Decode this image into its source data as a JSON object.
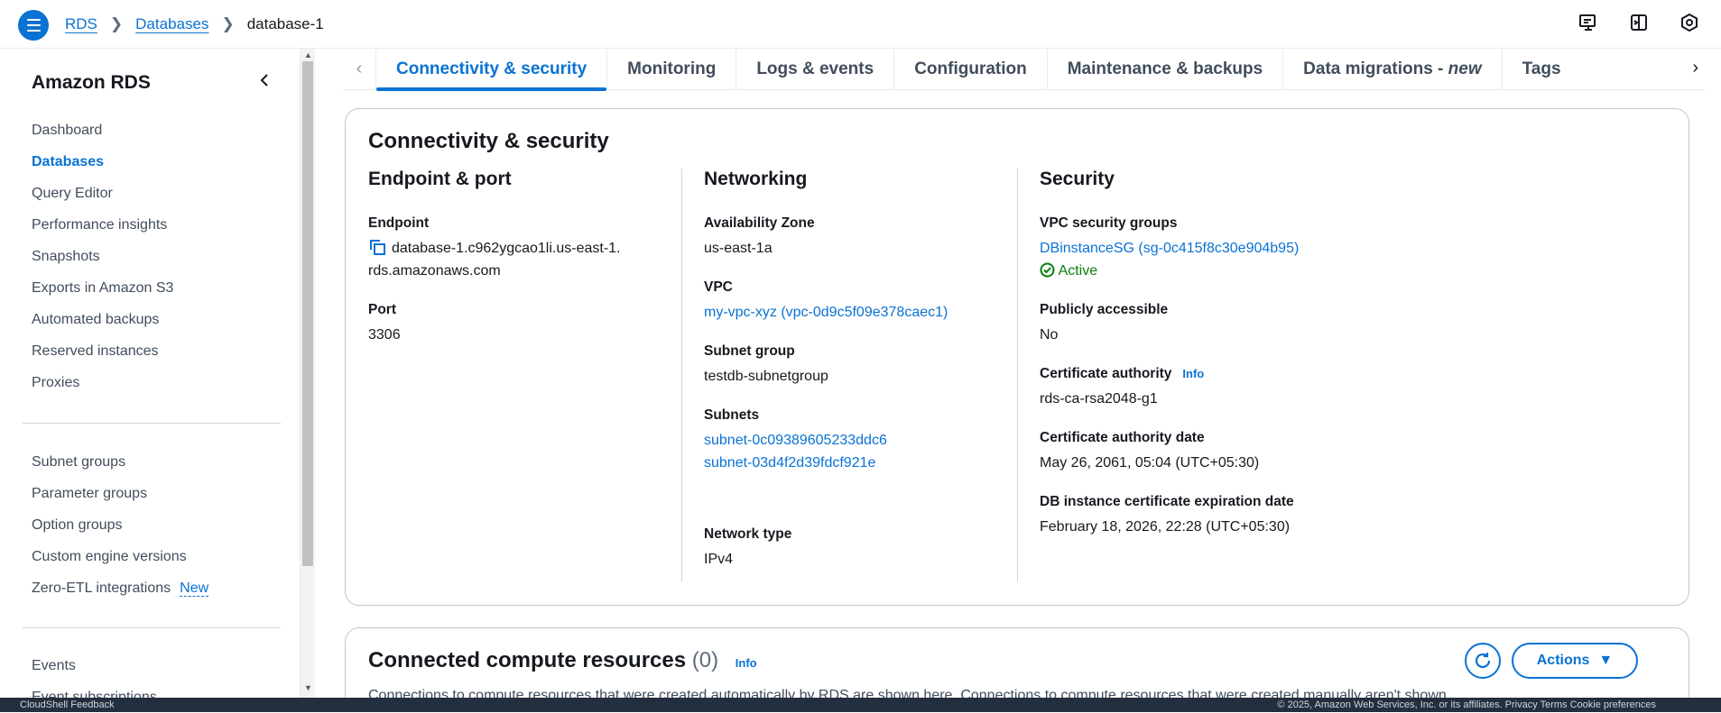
{
  "breadcrumb": {
    "items": [
      "RDS",
      "Databases"
    ],
    "current": "database-1"
  },
  "sidebar": {
    "title": "Amazon RDS",
    "group1": [
      {
        "label": "Dashboard",
        "active": false
      },
      {
        "label": "Databases",
        "active": true
      },
      {
        "label": "Query Editor",
        "active": false
      },
      {
        "label": "Performance insights",
        "active": false
      },
      {
        "label": "Snapshots",
        "active": false
      },
      {
        "label": "Exports in Amazon S3",
        "active": false
      },
      {
        "label": "Automated backups",
        "active": false
      },
      {
        "label": "Reserved instances",
        "active": false
      },
      {
        "label": "Proxies",
        "active": false
      }
    ],
    "group2": [
      {
        "label": "Subnet groups"
      },
      {
        "label": "Parameter groups"
      },
      {
        "label": "Option groups"
      },
      {
        "label": "Custom engine versions"
      },
      {
        "label": "Zero-ETL integrations",
        "badge": "New"
      }
    ],
    "group3": [
      {
        "label": "Events"
      },
      {
        "label": "Event subscriptions"
      }
    ]
  },
  "tabs": [
    {
      "label": "Connectivity & security",
      "active": true
    },
    {
      "label": "Monitoring"
    },
    {
      "label": "Logs & events"
    },
    {
      "label": "Configuration"
    },
    {
      "label": "Maintenance & backups"
    },
    {
      "label": "Data migrations - ",
      "suffix": "new"
    },
    {
      "label": "Tags"
    }
  ],
  "connectivity": {
    "title": "Connectivity & security",
    "endpoint_port": {
      "heading": "Endpoint & port",
      "endpoint_label": "Endpoint",
      "endpoint_line1": "database-1.c962ygcao1li.us-east-1.",
      "endpoint_line2": "rds.amazonaws.com",
      "port_label": "Port",
      "port_value": "3306"
    },
    "networking": {
      "heading": "Networking",
      "az_label": "Availability Zone",
      "az_value": "us-east-1a",
      "vpc_label": "VPC",
      "vpc_value": "my-vpc-xyz (vpc-0d9c5f09e378caec1)",
      "subnet_group_label": "Subnet group",
      "subnet_group_value": "testdb-subnetgroup",
      "subnets_label": "Subnets",
      "subnets": [
        "subnet-0c09389605233ddc6",
        "subnet-03d4f2d39fdcf921e"
      ],
      "network_type_label": "Network type",
      "network_type_value": "IPv4"
    },
    "security": {
      "heading": "Security",
      "sg_label": "VPC security groups",
      "sg_value": "DBinstanceSG (sg-0c415f8c30e904b95)",
      "sg_status": "Active",
      "public_label": "Publicly accessible",
      "public_value": "No",
      "ca_label": "Certificate authority",
      "ca_info": "Info",
      "ca_value": "rds-ca-rsa2048-g1",
      "ca_date_label": "Certificate authority date",
      "ca_date_value": "May 26, 2061, 05:04 (UTC+05:30)",
      "cert_exp_label": "DB instance certificate expiration date",
      "cert_exp_value": "February 18, 2026, 22:28 (UTC+05:30)"
    }
  },
  "compute": {
    "title": "Connected compute resources",
    "count": "(0)",
    "info": "Info",
    "description": "Connections to compute resources that were created automatically by RDS are shown here. Connections to compute resources that were created manually aren't shown.",
    "actions_label": "Actions"
  },
  "footer": {
    "left": "CloudShell   Feedback",
    "right": "© 2025, Amazon Web Services, Inc. or its affiliates.   Privacy   Terms   Cookie preferences"
  },
  "colors": {
    "accent": "#0972d3",
    "success": "#037f0c",
    "footer_bg": "#232f3e"
  }
}
